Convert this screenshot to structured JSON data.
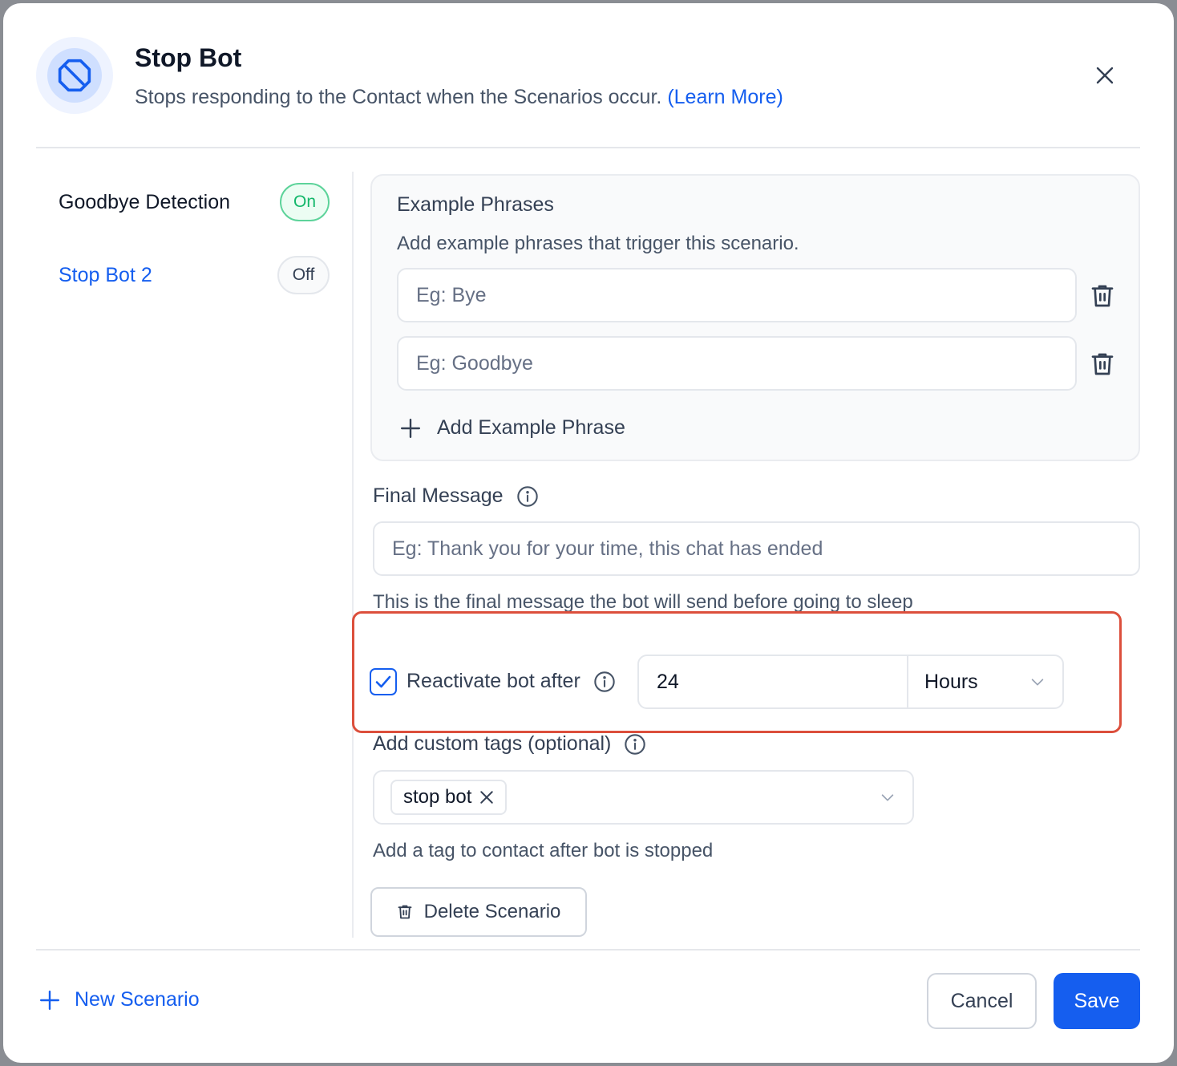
{
  "header": {
    "title": "Stop Bot",
    "subtitle": "Stops responding to the Contact when the Scenarios occur.",
    "learn_more": "(Learn More)"
  },
  "sidebar": {
    "items": [
      {
        "label": "Goodbye Detection",
        "status": "On"
      },
      {
        "label": "Stop Bot 2",
        "status": "Off"
      }
    ]
  },
  "example_phrases": {
    "title": "Example Phrases",
    "description": "Add example phrases that trigger this scenario.",
    "phrases": [
      {
        "placeholder": "Eg: Bye"
      },
      {
        "placeholder": "Eg: Goodbye"
      }
    ],
    "add_label": "Add Example Phrase"
  },
  "final_message": {
    "label": "Final Message",
    "placeholder": "Eg: Thank you for your time, this chat has ended",
    "helper": "This is the final message the bot will send before going to sleep"
  },
  "reactivate": {
    "label": "Reactivate bot after",
    "checked": true,
    "value": "24",
    "unit": "Hours"
  },
  "custom_tags": {
    "label": "Add custom tags (optional)",
    "tags": [
      "stop bot"
    ],
    "helper": "Add a tag to contact after bot is stopped"
  },
  "delete_scenario_label": "Delete Scenario",
  "footer": {
    "new_scenario": "New Scenario",
    "cancel": "Cancel",
    "save": "Save"
  },
  "colors": {
    "accent": "#155eef",
    "on": "#12b76a",
    "highlight": "#dc4f3c"
  }
}
